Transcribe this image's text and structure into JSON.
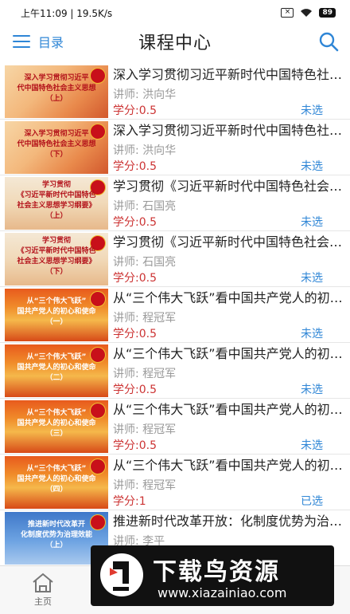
{
  "status": {
    "time": "上午11:09",
    "speed": "19.5K/s",
    "battery": "89"
  },
  "header": {
    "menu_label": "目录",
    "title": "课程中心"
  },
  "courses": [
    {
      "thumb_text": "深入学习贯彻习近平\n代中国特色社会主义思想\n（上）",
      "title": "深入学习贯彻习近平新时代中国特色社会主义思想（上）",
      "teacher": "讲师: 洪向华",
      "credit": "学分:0.5",
      "state": "未选"
    },
    {
      "thumb_text": "深入学习贯彻习近平\n代中国特色社会主义思想\n（下）",
      "title": "深入学习贯彻习近平新时代中国特色社会主义思想（下）",
      "teacher": "讲师: 洪向华",
      "credit": "学分:0.5",
      "state": "未选"
    },
    {
      "thumb_text": "学习贯彻\n《习近平新时代中国特色\n社会主义思想学习纲要》\n（上）",
      "title": "学习贯彻《习近平新时代中国特色社会主义思想学习纲要》（上）",
      "teacher": "讲师: 石国亮",
      "credit": "学分:0.5",
      "state": "未选"
    },
    {
      "thumb_text": "学习贯彻\n《习近平新时代中国特色\n社会主义思想学习纲要》\n（下）",
      "title": "学习贯彻《习近平新时代中国特色社会主义思想学习纲要》（下）",
      "teacher": "讲师: 石国亮",
      "credit": "学分:0.5",
      "state": "未选"
    },
    {
      "thumb_text": "从“三个伟大飞跃”\n国共产党人的初心和使命\n（一）",
      "title": "从“三个伟大飞跃”看中国共产党人的初心和使命（一）",
      "teacher": "讲师: 程冠军",
      "credit": "学分:0.5",
      "state": "未选"
    },
    {
      "thumb_text": "从“三个伟大飞跃”\n国共产党人的初心和使命\n（二）",
      "title": "从“三个伟大飞跃”看中国共产党人的初心和使命（二）",
      "teacher": "讲师: 程冠军",
      "credit": "学分:0.5",
      "state": "未选"
    },
    {
      "thumb_text": "从“三个伟大飞跃”\n国共产党人的初心和使命\n（三）",
      "title": "从“三个伟大飞跃”看中国共产党人的初心和使命（三）",
      "teacher": "讲师: 程冠军",
      "credit": "学分:0.5",
      "state": "未选"
    },
    {
      "thumb_text": "从“三个伟大飞跃”\n国共产党人的初心和使命\n（四）",
      "title": "从“三个伟大飞跃”看中国共产党人的初心和使命（四）",
      "teacher": "讲师: 程冠军",
      "credit": "学分:1",
      "state": "已选"
    },
    {
      "thumb_text": "推进新时代改革开\n化制度优势为治理效能\n（上）",
      "title": "推进新时代改革开放：化制度优势为治理效能（上）",
      "teacher": "讲师: 李平",
      "credit": "",
      "state": ""
    }
  ],
  "tabbar": {
    "home_label": "主页"
  },
  "watermark": {
    "cn": "下载鸟资源",
    "url": "www.xiazainiao.com"
  },
  "colors": {
    "accent": "#2f86d6",
    "credit": "#cc3333"
  }
}
